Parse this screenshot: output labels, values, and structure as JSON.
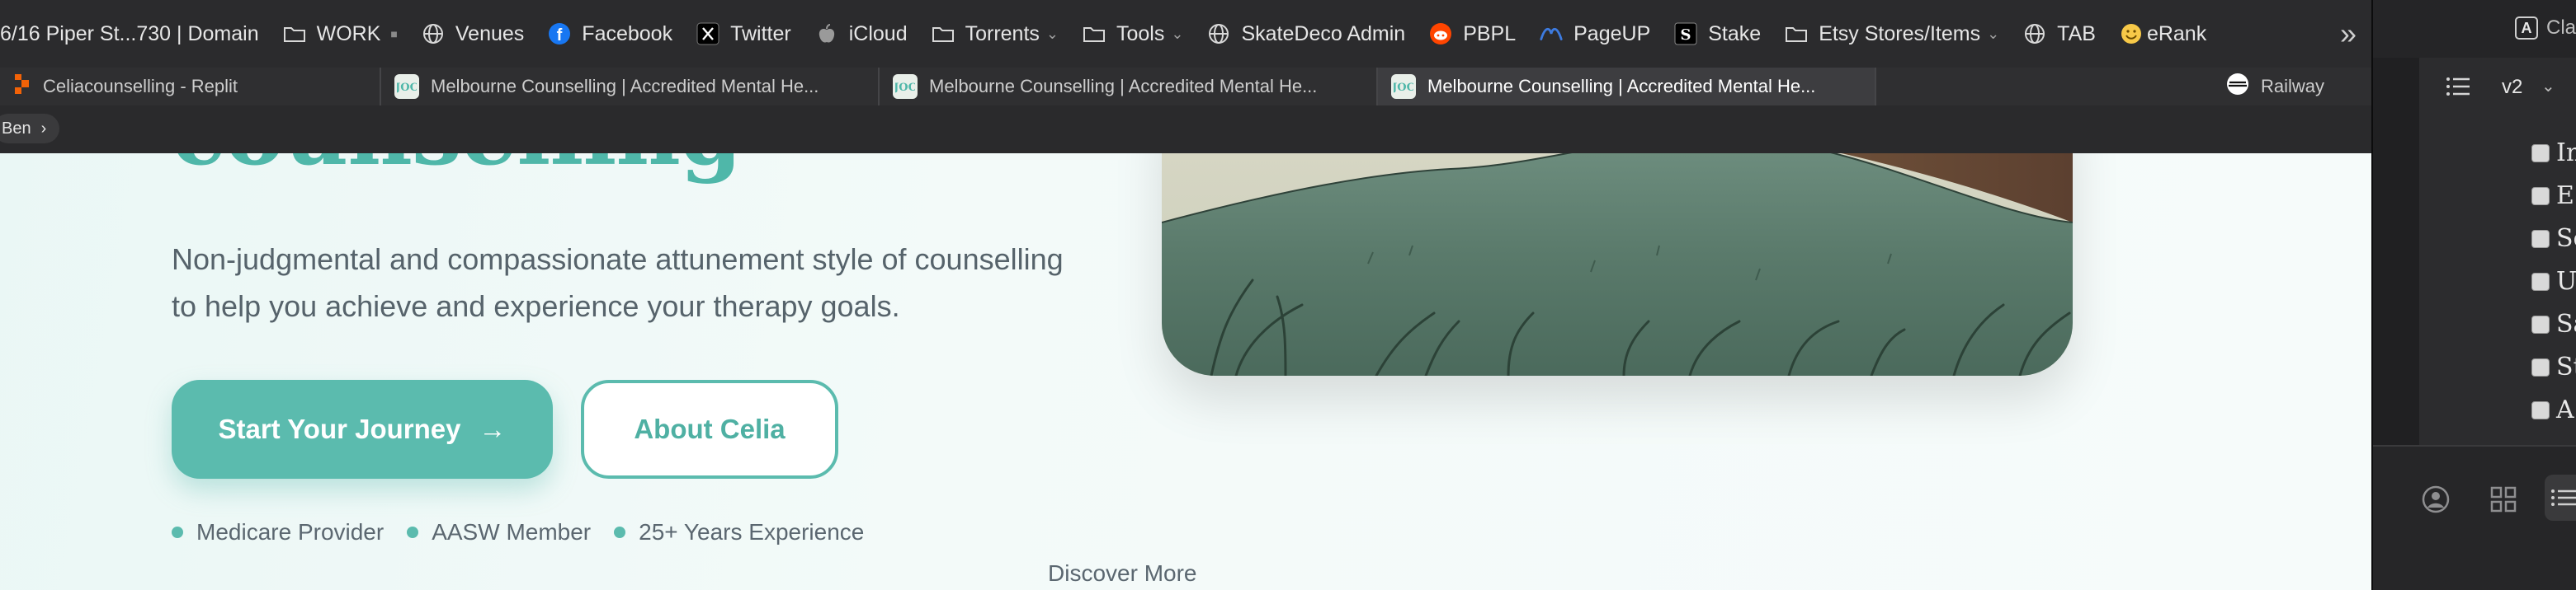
{
  "bookmarks": [
    {
      "label": "6/16 Piper St...730 | Domain",
      "icon": "none"
    },
    {
      "label": "WORK",
      "icon": "folder-icon",
      "suffix": "■"
    },
    {
      "label": "Venues",
      "icon": "globe-icon"
    },
    {
      "label": "Facebook",
      "icon": "facebook-icon"
    },
    {
      "label": "Twitter",
      "icon": "x-icon"
    },
    {
      "label": "iCloud",
      "icon": "apple-icon"
    },
    {
      "label": "Torrents",
      "icon": "folder-icon",
      "chevron": true
    },
    {
      "label": "Tools",
      "icon": "folder-icon",
      "chevron": true
    },
    {
      "label": "SkateDeco Admin",
      "icon": "globe-icon"
    },
    {
      "label": "PBPL",
      "icon": "reddit-icon"
    },
    {
      "label": "PageUP",
      "icon": "pageup-icon"
    },
    {
      "label": "Stake",
      "icon": "stake-icon"
    },
    {
      "label": "Etsy Stores/Items",
      "icon": "folder-icon",
      "chevron": true
    },
    {
      "label": "TAB",
      "icon": "globe-icon"
    },
    {
      "label": "eRank",
      "icon": "emoji-icon"
    }
  ],
  "bookmarks_overflow": "»",
  "tabs": [
    {
      "label": "Celiacounselling - Replit",
      "favicon": "replit-icon",
      "active": false
    },
    {
      "label": "Melbourne Counselling | Accredited Mental He...",
      "favicon": "site-icon",
      "active": false
    },
    {
      "label": "Melbourne Counselling | Accredited Mental He...",
      "favicon": "site-icon",
      "active": false
    },
    {
      "label": "Melbourne Counselling | Accredited Mental He...",
      "favicon": "site-icon",
      "active": true
    },
    {
      "label": "Railway",
      "favicon": "railway-icon",
      "active": false
    }
  ],
  "breadcrumb": {
    "label": "Ben",
    "chevron": "›"
  },
  "hero": {
    "title": "counselling",
    "subtitle_line1": "Non-judgmental and compassionate attunement style of counselling",
    "subtitle_line2": "to help you achieve and experience your therapy goals.",
    "primary_button": "Start Your Journey",
    "primary_arrow": "→",
    "secondary_button": "About Celia",
    "credentials": [
      "Medicare Provider",
      "AASW Member",
      "25+ Years Experience"
    ],
    "discover": "Discover More"
  },
  "right_app": {
    "header_badge": "A",
    "header_text": "Cla",
    "version": "v2",
    "checkbox_letters": [
      "In",
      "E",
      "Sc",
      "U",
      "Sa",
      "St",
      "A"
    ]
  },
  "colors": {
    "accent": "#5bbbae",
    "title": "#4fb7a9",
    "body_text": "#56636b",
    "chrome_bg": "#2b2b2d"
  }
}
